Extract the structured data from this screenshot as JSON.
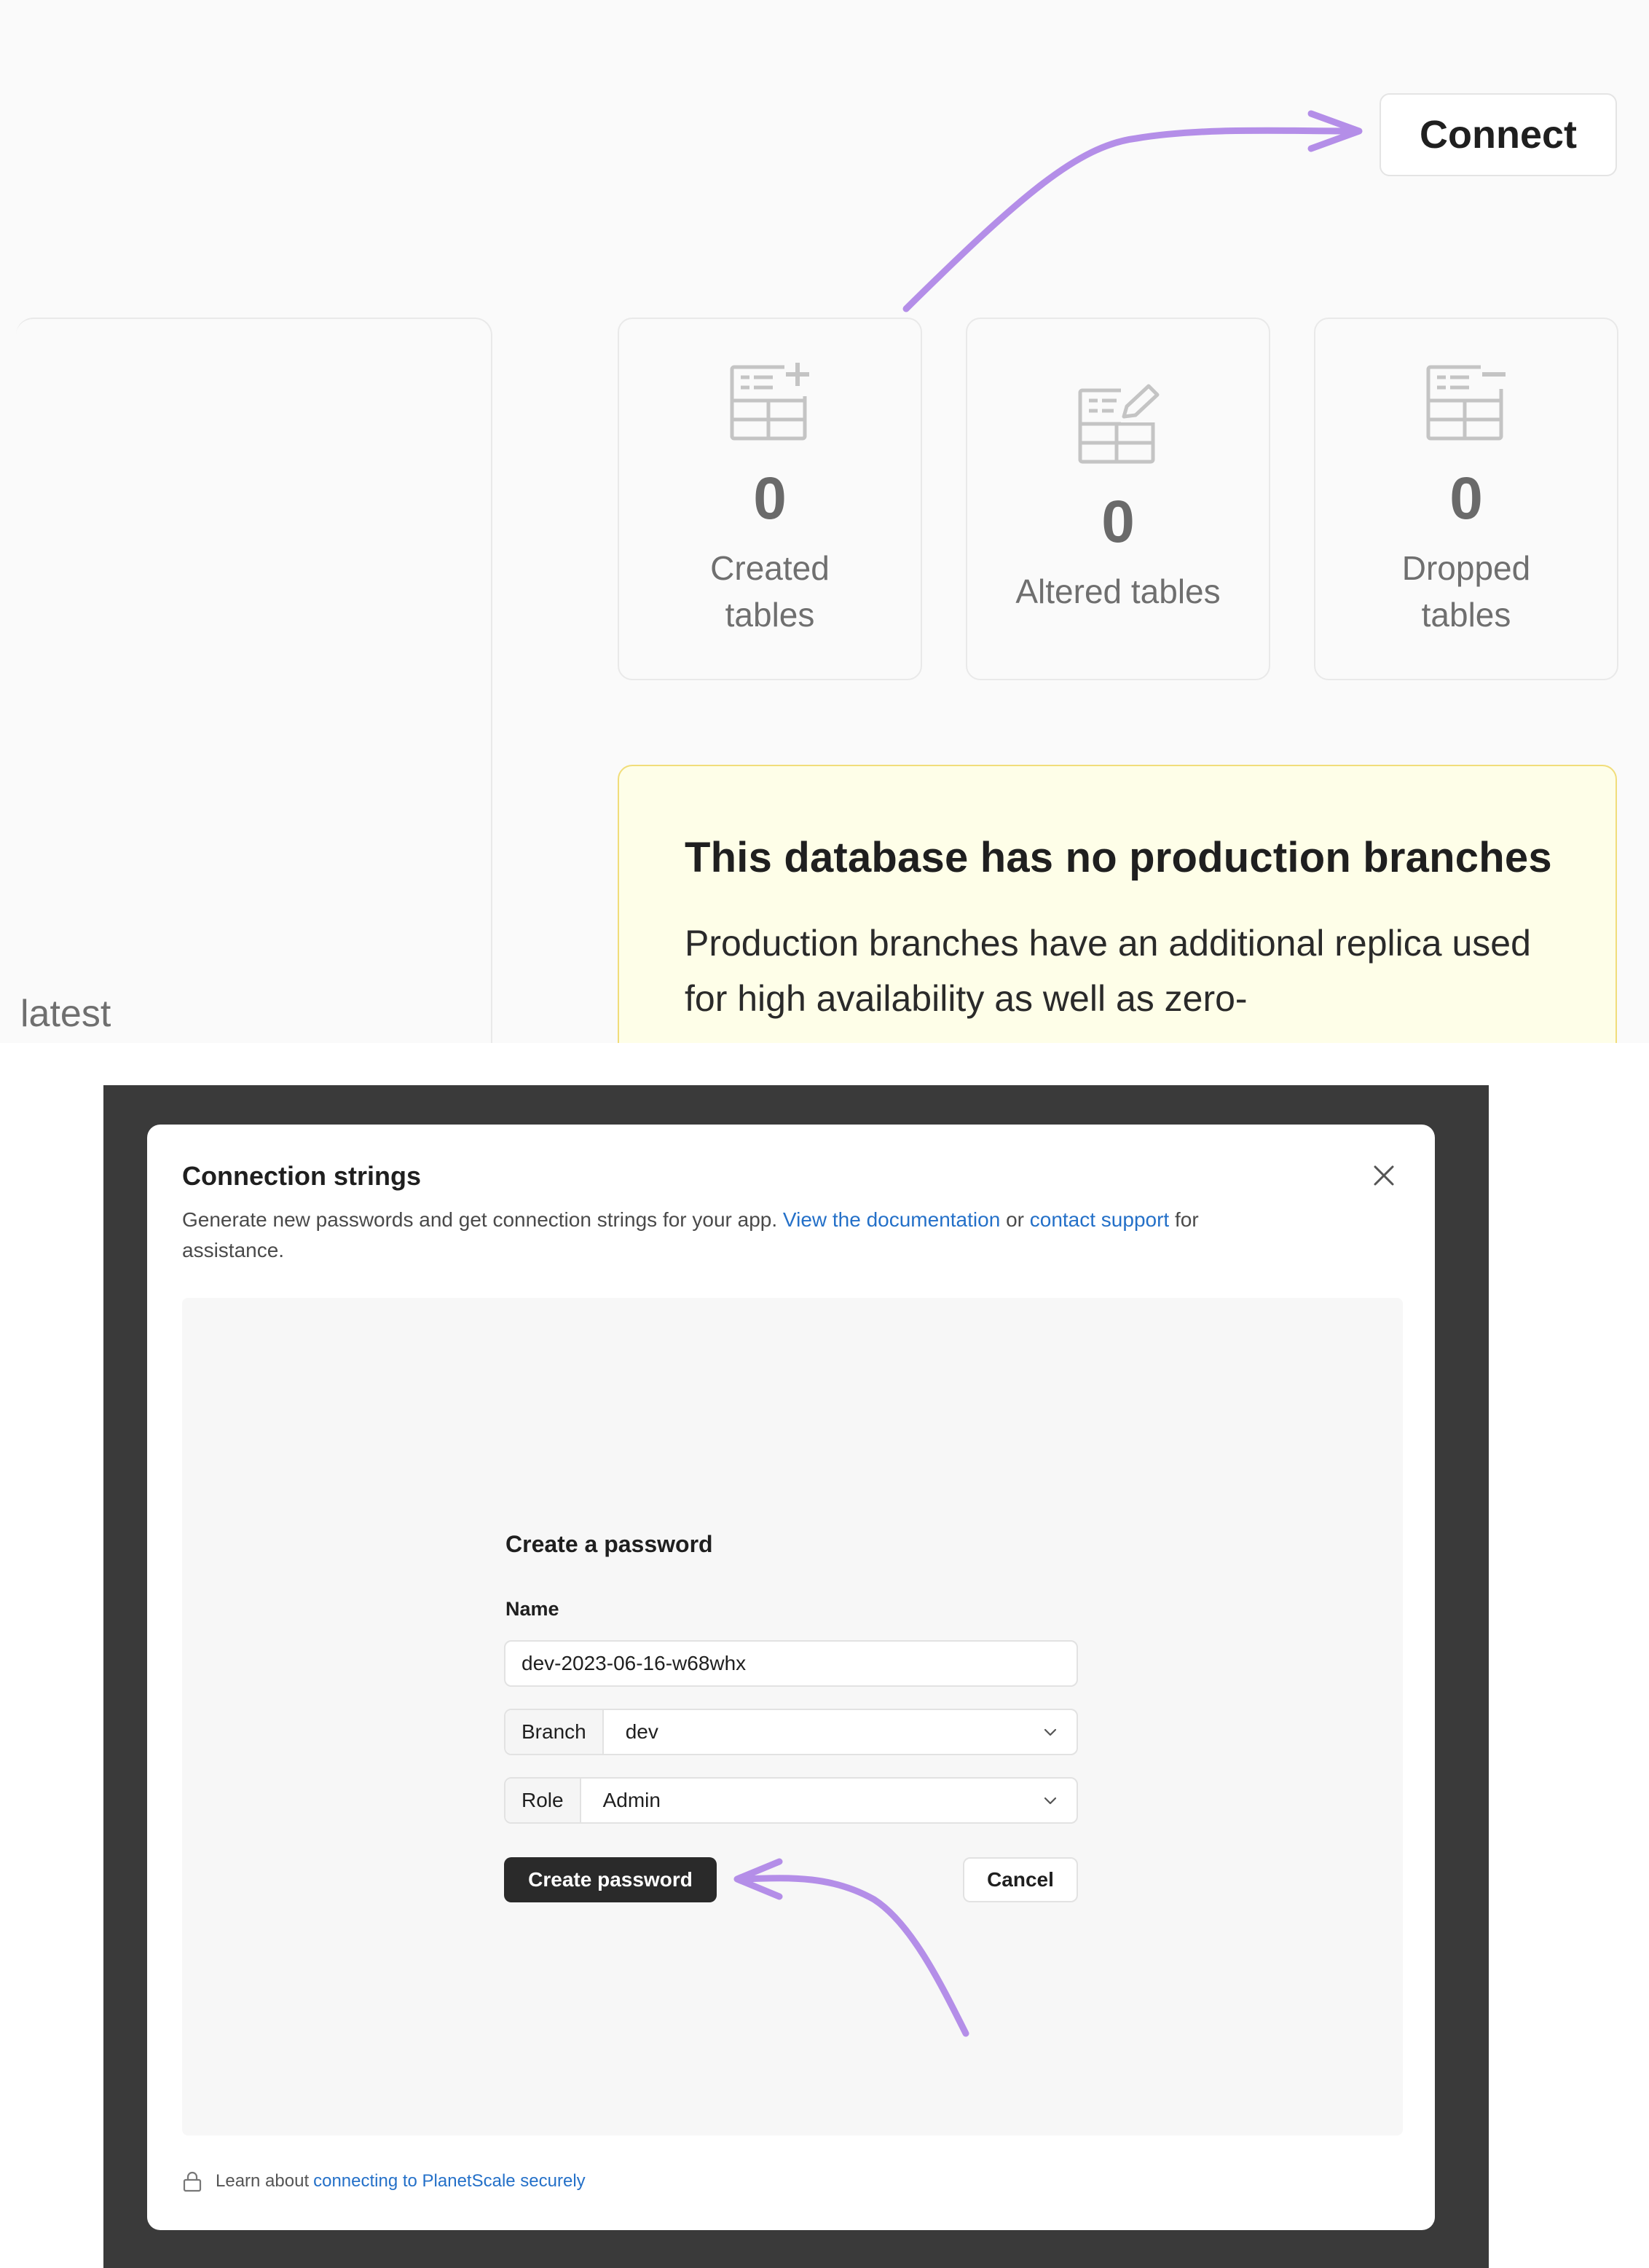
{
  "top": {
    "connect_label": "Connect",
    "latest_text": "latest",
    "stats": [
      {
        "icon": "table-plus-icon",
        "value": "0",
        "label": "Created tables"
      },
      {
        "icon": "table-edit-icon",
        "value": "0",
        "label": "Altered tables"
      },
      {
        "icon": "table-minus-icon",
        "value": "0",
        "label": "Dropped tables"
      }
    ],
    "notice": {
      "title": "This database has no production branches",
      "body": "Production branches have an additional replica used for high availability as well as zero-"
    }
  },
  "modal": {
    "title": "Connection strings",
    "desc_text": "Generate new passwords and get connection strings for your app.",
    "desc_link_docs": "View the documentation",
    "desc_or": "or",
    "desc_link_support": "contact support",
    "desc_tail": "for assistance.",
    "form": {
      "title": "Create a password",
      "name_label": "Name",
      "name_value": "dev-2023-06-16-w68whx",
      "branch_label": "Branch",
      "branch_value": "dev",
      "role_label": "Role",
      "role_value": "Admin",
      "create_label": "Create password",
      "cancel_label": "Cancel"
    },
    "footer": {
      "text": "Learn about",
      "link": "connecting to PlanetScale securely"
    }
  },
  "colors": {
    "annotation_arrow": "#b48ee8",
    "link": "#2470c8",
    "notice_bg": "#fefee8",
    "notice_border": "#f1dd7a",
    "primary_button": "#2a2a2a"
  }
}
